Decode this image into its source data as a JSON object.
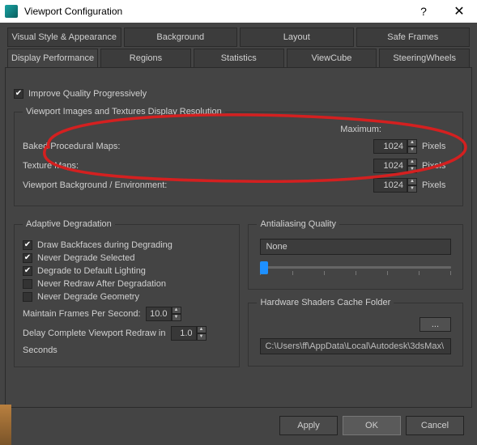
{
  "title": "Viewport Configuration",
  "tabs_row1": [
    {
      "label": "Visual Style & Appearance"
    },
    {
      "label": "Background"
    },
    {
      "label": "Layout"
    },
    {
      "label": "Safe Frames"
    }
  ],
  "tabs_row2": [
    {
      "label": "Display Performance",
      "active": true
    },
    {
      "label": "Regions"
    },
    {
      "label": "Statistics"
    },
    {
      "label": "ViewCube"
    },
    {
      "label": "SteeringWheels"
    }
  ],
  "improve_quality": {
    "label": "Improve Quality Progressively",
    "checked": true
  },
  "res_group": {
    "title": "Viewport Images and Textures Display Resolution",
    "max_header": "Maximum:",
    "rows": {
      "baked": {
        "label": "Baked Procedural Maps:",
        "value": "1024",
        "unit": "Pixels"
      },
      "tex": {
        "label": "Texture Maps:",
        "value": "1024",
        "unit": "Pixels"
      },
      "bg": {
        "label": "Viewport Background / Environment:",
        "value": "1024",
        "unit": "Pixels"
      }
    }
  },
  "adaptive": {
    "title": "Adaptive Degradation",
    "items": {
      "backfaces": {
        "label": "Draw Backfaces during Degrading",
        "checked": true
      },
      "never_sel": {
        "label": "Never Degrade Selected",
        "checked": true
      },
      "def_light": {
        "label": "Degrade to Default Lighting",
        "checked": true
      },
      "never_redraw": {
        "label": "Never Redraw After Degradation",
        "checked": false
      },
      "never_geom": {
        "label": "Never Degrade Geometry",
        "checked": false
      }
    },
    "fps": {
      "label": "Maintain Frames Per Second:",
      "value": "10.0"
    },
    "delay": {
      "label_pre": "Delay Complete Viewport Redraw in",
      "value": "1.0",
      "label_post": "Seconds"
    }
  },
  "aa": {
    "title": "Antialiasing Quality",
    "value": "None"
  },
  "cache": {
    "title": "Hardware Shaders Cache Folder",
    "browse": "...",
    "path": "C:\\Users\\ff\\AppData\\Local\\Autodesk\\3dsMax\\"
  },
  "buttons": {
    "apply": "Apply",
    "ok": "OK",
    "cancel": "Cancel"
  }
}
